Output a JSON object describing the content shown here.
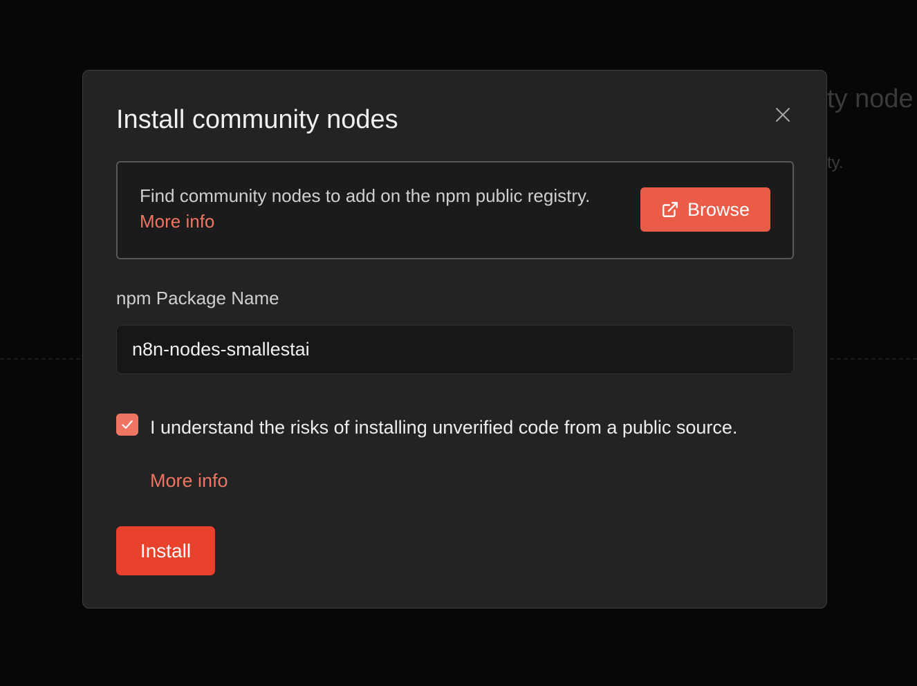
{
  "background": {
    "title_fragment": "ty node",
    "subtitle_fragment": "ty."
  },
  "modal": {
    "title": "Install community nodes",
    "close_icon": "close-icon",
    "info": {
      "text": "Find community nodes to add on the npm public registry.",
      "link": "More info",
      "browse_label": "Browse",
      "browse_icon": "external-link-icon"
    },
    "package_field": {
      "label": "npm Package Name",
      "value": "n8n-nodes-smallestai"
    },
    "consent": {
      "checked": true,
      "text": "I understand the risks of installing unverified code from a public source.",
      "link": "More info"
    },
    "install_label": "Install"
  },
  "colors": {
    "accent": "#ea5c48",
    "install": "#e8412c",
    "link": "#ee7561",
    "modal_bg": "#232323"
  }
}
